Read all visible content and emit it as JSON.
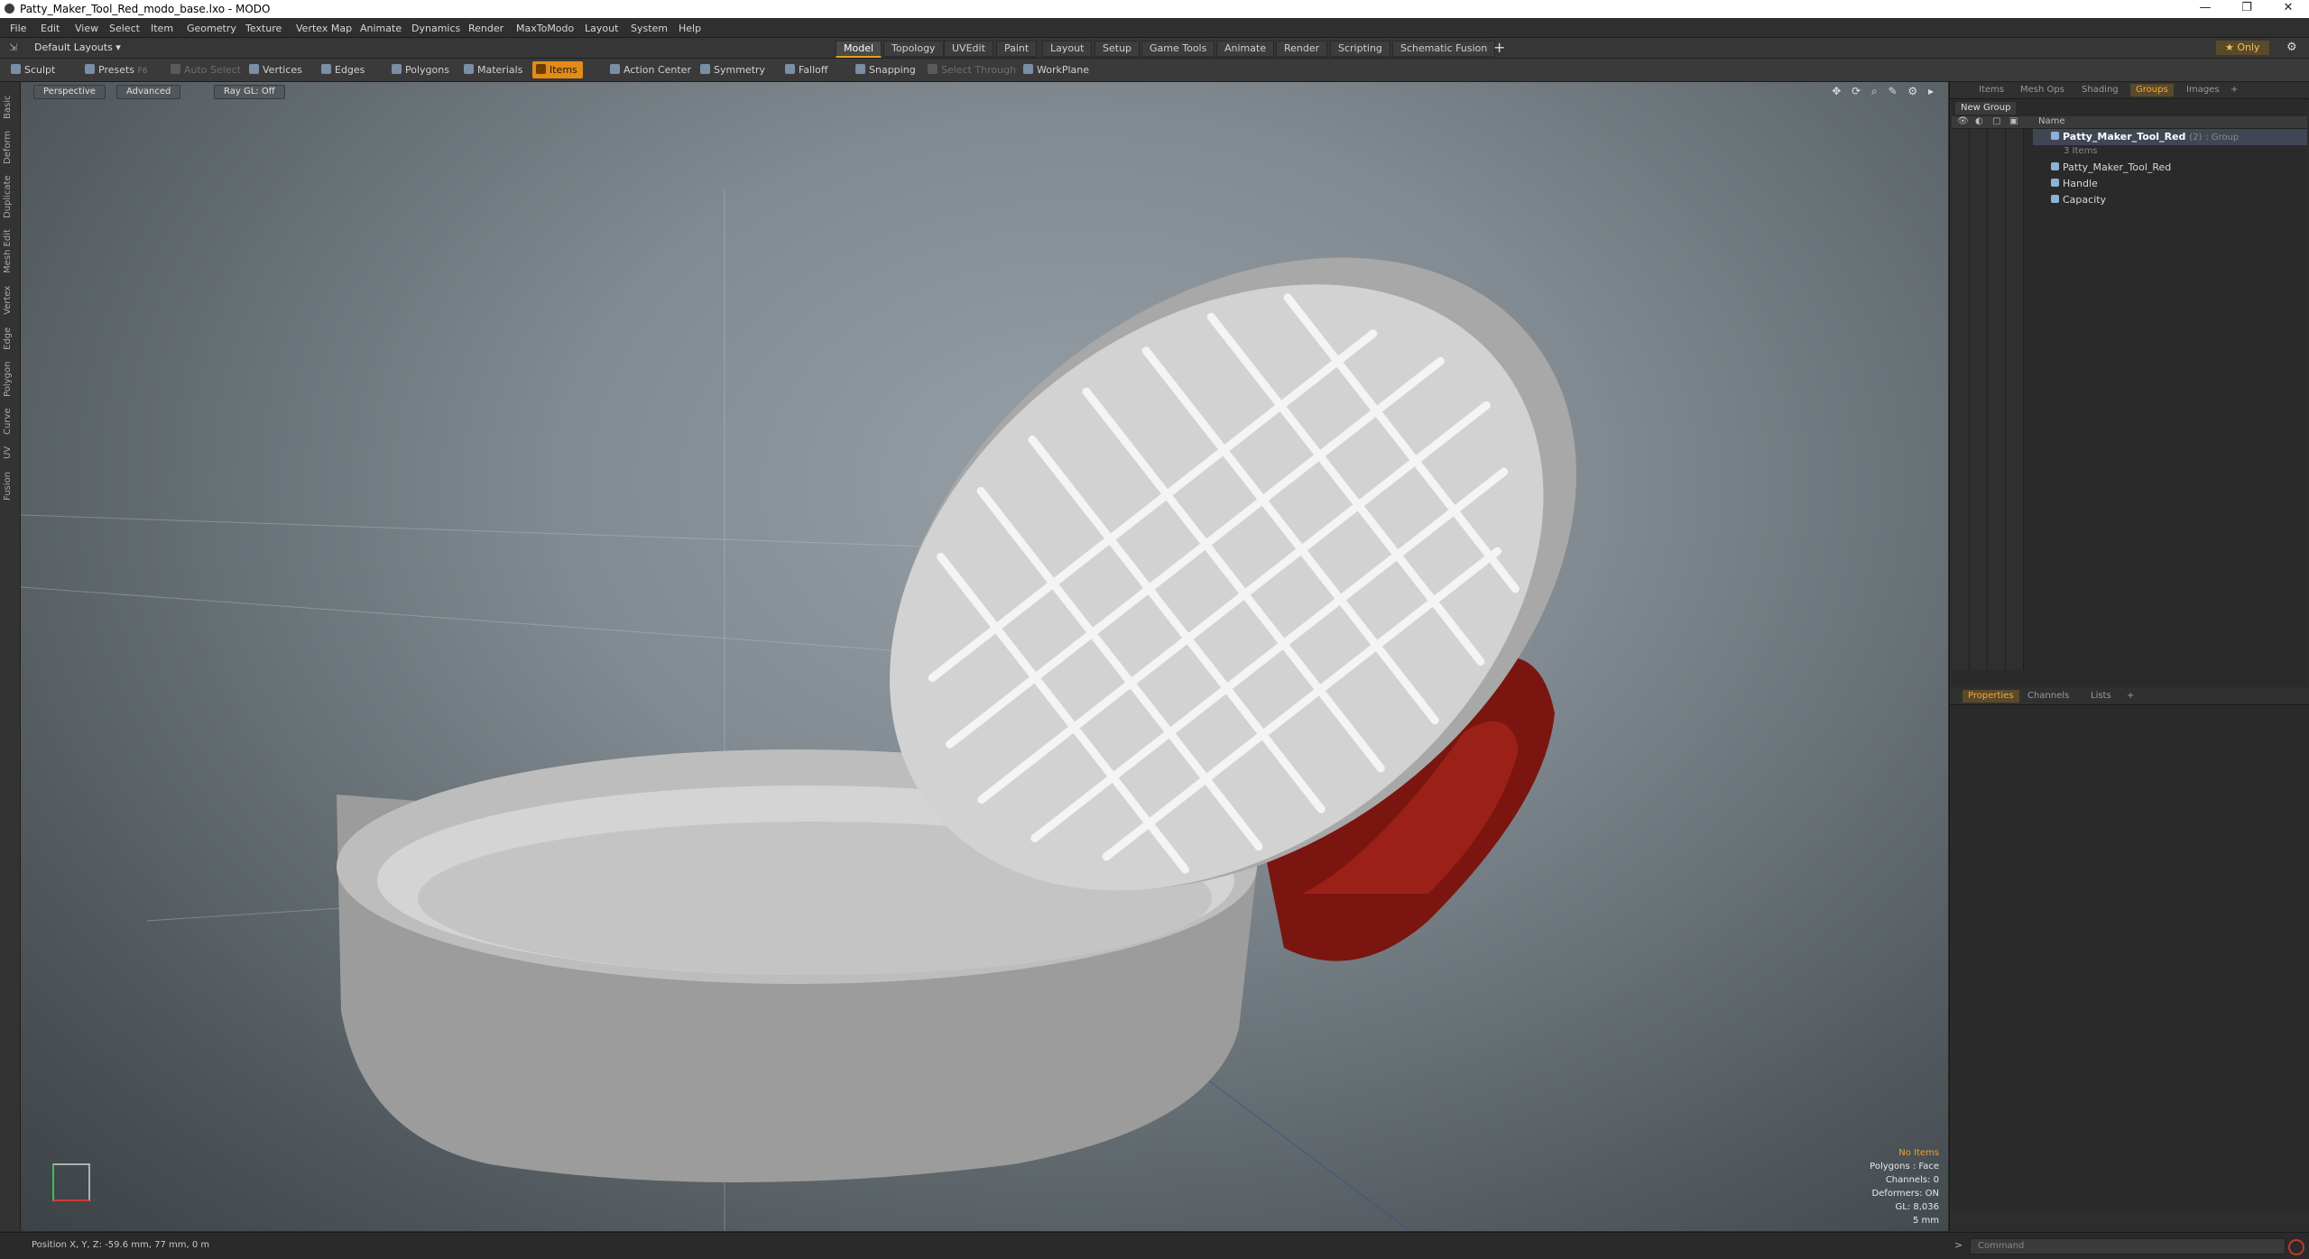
{
  "window": {
    "title": "Patty_Maker_Tool_Red_modo_base.lxo - MODO",
    "minimize": "—",
    "maximize": "❐",
    "close": "✕"
  },
  "menu": [
    "File",
    "Edit",
    "View",
    "Select",
    "Item",
    "Geometry",
    "Texture",
    "Vertex Map",
    "Animate",
    "Dynamics",
    "Render",
    "MaxToModo",
    "Layout",
    "System",
    "Help"
  ],
  "layouts": {
    "selector": "Default Layouts ▾",
    "tabs": [
      "Model",
      "Topology",
      "UVEdit",
      "Paint",
      "Layout",
      "Setup",
      "Game Tools",
      "Animate",
      "Render",
      "Scripting",
      "Schematic Fusion"
    ],
    "active_tab": "Model",
    "add": "+",
    "only": "★ Only",
    "gear": "⚙"
  },
  "toolbar": {
    "items": [
      {
        "label": "Sculpt",
        "state": "normal"
      },
      {
        "label": "Presets",
        "state": "normal"
      },
      {
        "label": "Auto Select",
        "state": "dim"
      },
      {
        "label": "Vertices",
        "state": "normal"
      },
      {
        "label": "Edges",
        "state": "normal"
      },
      {
        "label": "Polygons",
        "state": "normal"
      },
      {
        "label": "Materials",
        "state": "normal"
      },
      {
        "label": "Items",
        "state": "active"
      },
      {
        "label": "Action Center",
        "state": "normal"
      },
      {
        "label": "Symmetry",
        "state": "normal"
      },
      {
        "label": "Falloff",
        "state": "normal"
      },
      {
        "label": "Snapping",
        "state": "normal"
      },
      {
        "label": "Select Through",
        "state": "dim"
      },
      {
        "label": "WorkPlane",
        "state": "normal"
      }
    ],
    "presets_shortcut": "F6"
  },
  "left_tabs": [
    "Basic",
    "Deform",
    "Duplicate",
    "Mesh Edit",
    "Vertex",
    "Edge",
    "Polygon",
    "Curve",
    "UV",
    "Fusion"
  ],
  "viewport": {
    "buttons": [
      "Perspective",
      "Advanced",
      "Ray GL: Off"
    ],
    "stats": {
      "no_items": "No Items",
      "polygons": "Polygons : Face",
      "channels": "Channels: 0",
      "deformers": "Deformers: ON",
      "gl": "GL: 8,036",
      "grid": "5 mm"
    }
  },
  "right_panel": {
    "top_tabs": [
      "Items",
      "Mesh Ops",
      "Shading",
      "Groups",
      "Images",
      "+"
    ],
    "active_top_tab": "Groups",
    "new_group": "New Group",
    "name_header": "Name",
    "group": {
      "name": "Patty_Maker_Tool_Red",
      "count": "(2)",
      "type": ": Group",
      "items_label": "3 Items"
    },
    "children": [
      "Patty_Maker_Tool_Red",
      "Handle",
      "Capacity"
    ],
    "bottom_tabs": [
      "Properties",
      "Channels",
      "Lists",
      "+"
    ],
    "active_bottom_tab": "Properties"
  },
  "status": {
    "position": "Position X, Y, Z:  -59.6 mm, 77 mm, 0 m",
    "command_placeholder": "Command"
  },
  "colors": {
    "accent": "#e38b17",
    "handle_red": "#8b1a14",
    "viewport_bg": "#808a90"
  }
}
